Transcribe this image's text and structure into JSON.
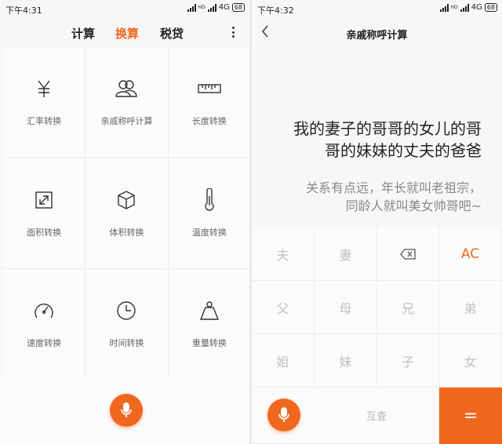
{
  "left": {
    "status": {
      "time": "下午4:31",
      "network": "4G",
      "battery": "68"
    },
    "tabs": [
      "计算",
      "换算",
      "税贷"
    ],
    "active_tab": "换算",
    "tiles": [
      {
        "label": "汇率转换",
        "icon": "yen-icon"
      },
      {
        "label": "亲戚称呼计算",
        "icon": "relatives-icon"
      },
      {
        "label": "长度转换",
        "icon": "ruler-icon"
      },
      {
        "label": "面积转换",
        "icon": "area-icon"
      },
      {
        "label": "体积转换",
        "icon": "cube-icon"
      },
      {
        "label": "温度转换",
        "icon": "thermometer-icon"
      },
      {
        "label": "速度转换",
        "icon": "speedometer-icon"
      },
      {
        "label": "时间转换",
        "icon": "clock-icon"
      },
      {
        "label": "重量转换",
        "icon": "weight-icon"
      }
    ]
  },
  "right": {
    "status": {
      "time": "下午4:32",
      "network": "4G",
      "battery": "68"
    },
    "title": "亲戚称呼计算",
    "expression_line1": "我的妻子的哥哥的女儿的哥",
    "expression_line2": "哥的妹妹的丈夫的爸爸",
    "result_line1": "关系有点远，年长就叫老祖宗，",
    "result_line2": "同龄人就叫美女帅哥吧~",
    "keys": {
      "husband": "夫",
      "wife": "妻",
      "clear": "AC",
      "father": "父",
      "mother": "母",
      "elder_brother": "兄",
      "younger_brother": "弟",
      "elder_sister": "姐",
      "younger_sister": "妹",
      "son": "子",
      "daughter": "女",
      "mutual_query": "互查",
      "equals": "="
    }
  }
}
